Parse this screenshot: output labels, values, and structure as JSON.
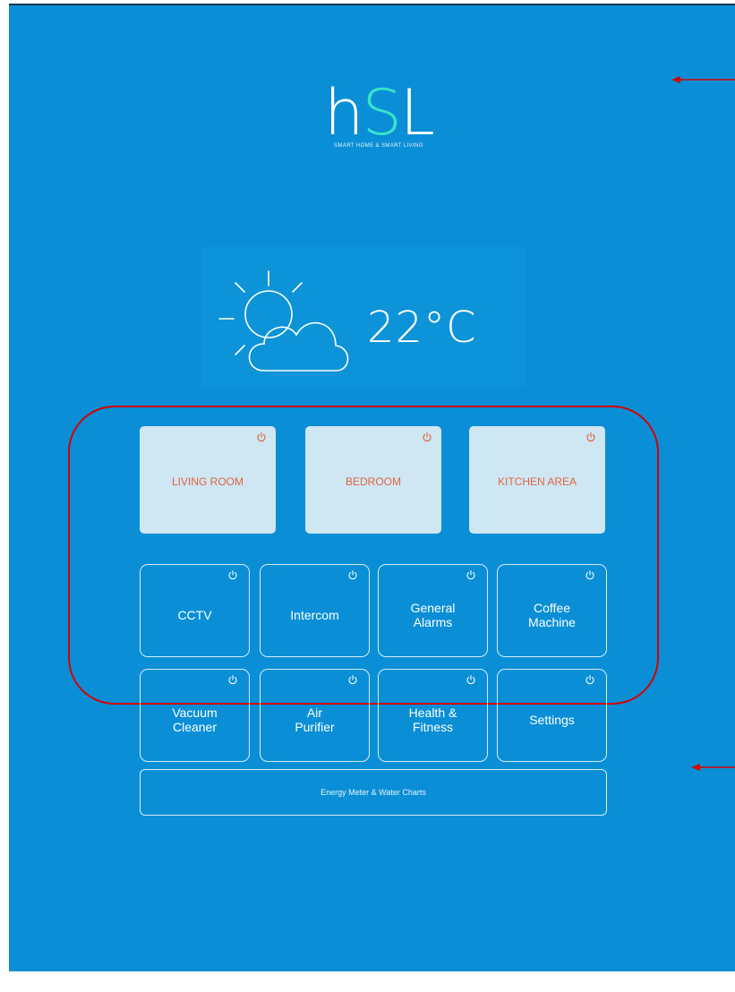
{
  "brand": {
    "logo_h": "h",
    "logo_s": "S",
    "logo_l": "L",
    "tagline": "SMART HOME & SMART LIVING",
    "accent": "#39e3c8"
  },
  "weather": {
    "icon": "partly-cloudy-icon",
    "temperature": "22°C"
  },
  "rooms": [
    {
      "label": "LIVING ROOM"
    },
    {
      "label": "BEDROOM"
    },
    {
      "label": "KITCHEN AREA"
    }
  ],
  "devices": [
    {
      "label": "CCTV"
    },
    {
      "label": "Intercom"
    },
    {
      "label": "General\nAlarms"
    },
    {
      "label": "Coffee\nMachine"
    },
    {
      "label": "Vacuum\nCleaner"
    },
    {
      "label": "Air\nPurifier"
    },
    {
      "label": "Health &\nFitness"
    },
    {
      "label": "Settings"
    }
  ],
  "energy": {
    "label": "Energy Meter & Water Charts"
  },
  "colors": {
    "background": "#0a8fd6",
    "room_tile": "#cfe6f3",
    "room_text": "#e06640",
    "highlight": "#d40000"
  }
}
